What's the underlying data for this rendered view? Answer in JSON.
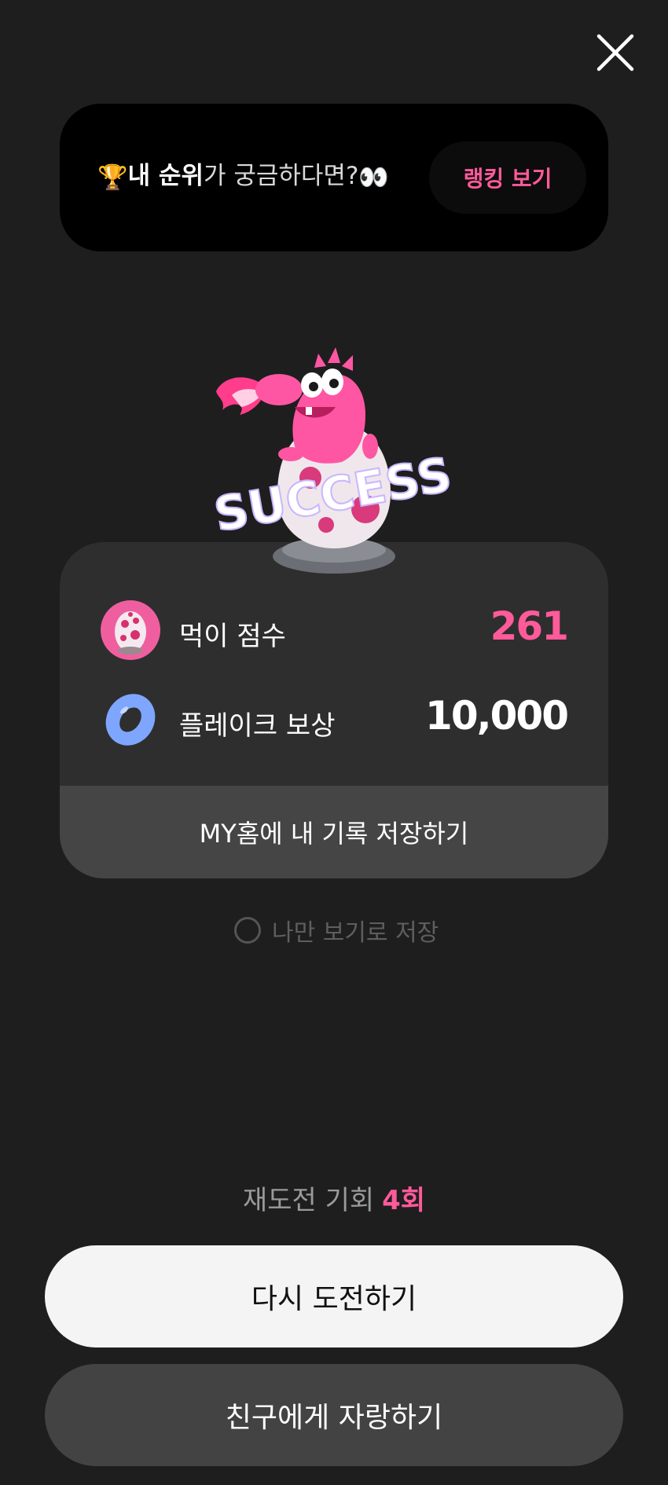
{
  "close": {
    "icon": "close-icon"
  },
  "rank_banner": {
    "trophy_icon": "🏆",
    "text_bold": "내 순위",
    "text_rest": "가 궁금하다면?",
    "eyes_icon": "👀",
    "button_label": "랭킹 보기"
  },
  "result": {
    "score_label": "먹이 점수",
    "score_value": "261",
    "reward_label": "플레이크 보상",
    "reward_value": "10,000",
    "save_home_label": "MY홈에 내 기록 저장하기"
  },
  "private_option": {
    "label": "나만 보기로 저장",
    "checked": false
  },
  "retry": {
    "label": "재도전 기회",
    "count": "4회"
  },
  "buttons": {
    "retry_label": "다시 도전하기",
    "share_label": "친구에게 자랑하기"
  },
  "colors": {
    "background": "#1e1e1e",
    "accent": "#ff5a9a",
    "card": "#2e2e2e",
    "banner": "#000000"
  }
}
